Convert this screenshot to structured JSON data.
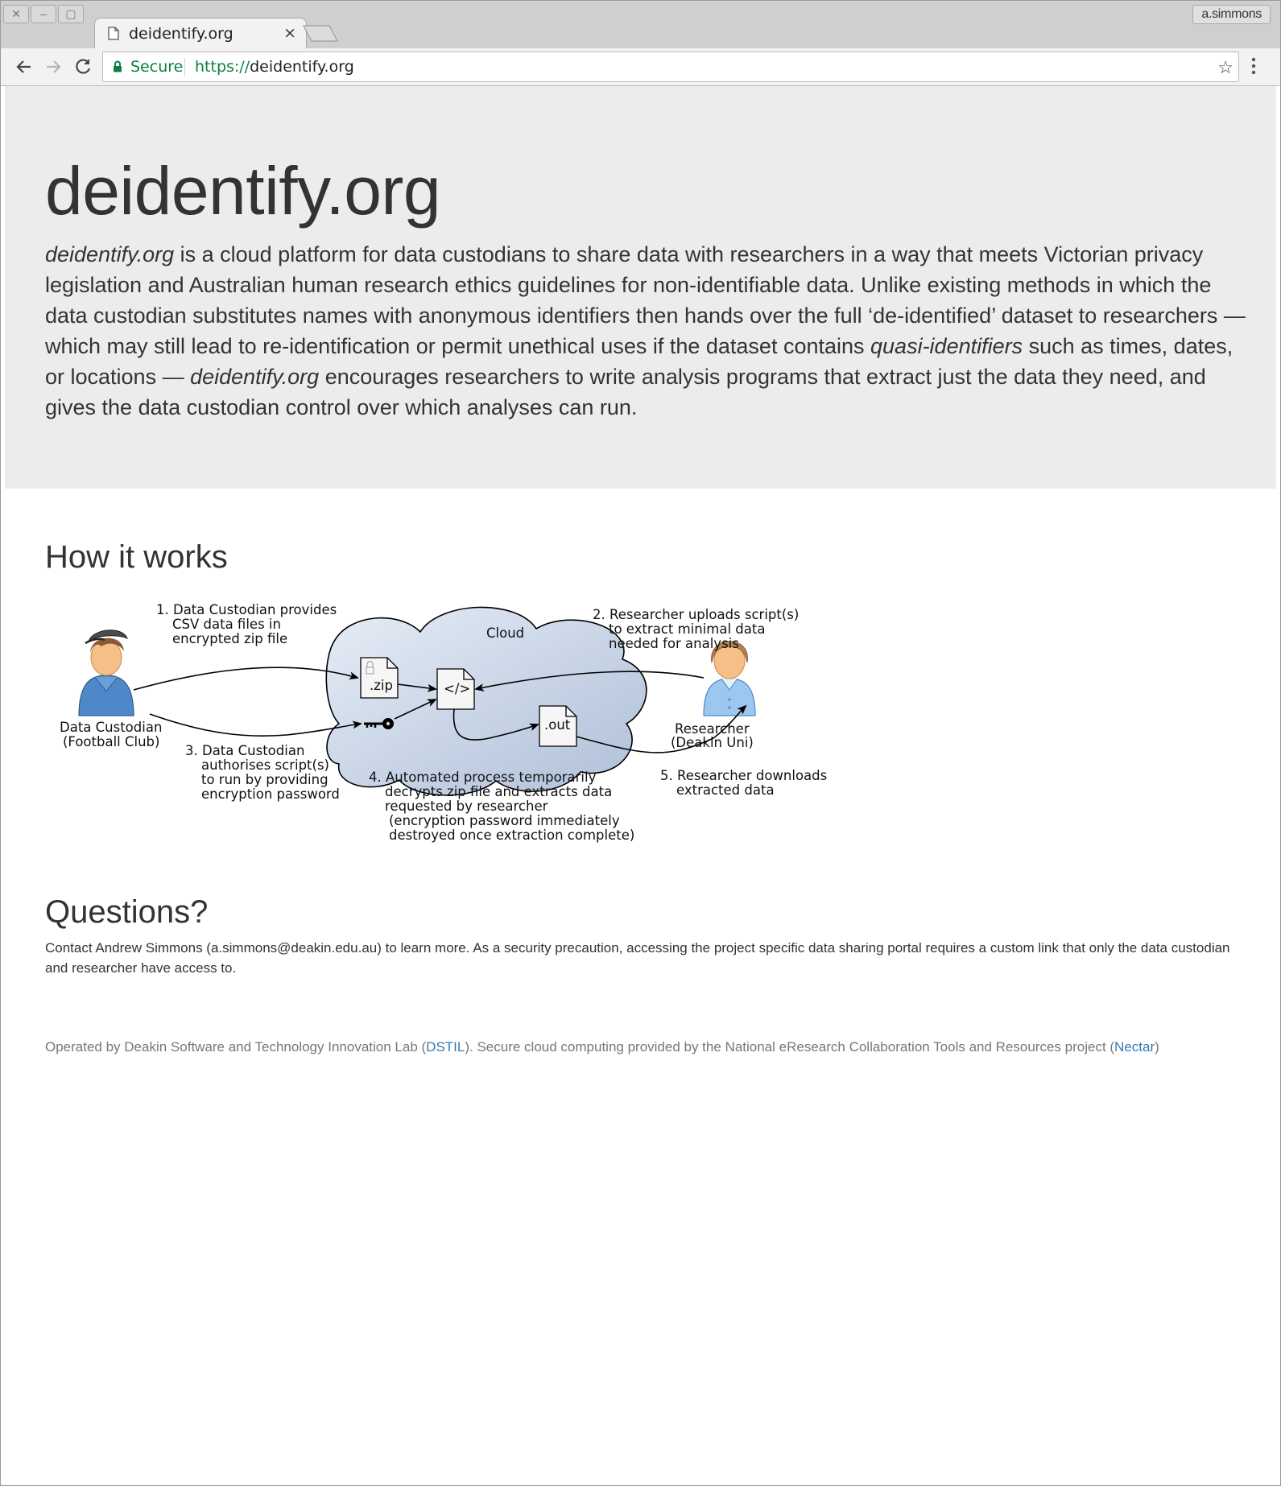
{
  "browser": {
    "tab_title": "deidentify.org",
    "tab_close": "×",
    "profile": "a.simmons",
    "secure_label": "Secure",
    "url_scheme": "https://",
    "url_host": "deidentify.org"
  },
  "hero": {
    "title": "deidentify.org",
    "lead_em_1": "deidentify.org",
    "lead_1": " is a cloud platform for data custodians to share data with researchers in a way that meets Victorian privacy legislation and Australian human research ethics guidelines for non-identifiable data. Unlike existing methods in which the data custodian substitutes names with anonymous identifiers then hands over the full ‘de-identified’ dataset to researchers — which may still lead to re-identification or permit unethical uses if the dataset contains ",
    "lead_em_2": "quasi-identifiers",
    "lead_2": " such as times, dates, or locations — ",
    "lead_em_3": "deidentify.org",
    "lead_3": " encourages researchers to write analysis programs that extract just the data they need, and gives the data custodian control over which analyses can run."
  },
  "how_it_works": {
    "heading": "How it works",
    "cloud_label": "Cloud",
    "zip_label": ".zip",
    "script_label": "</>",
    "out_label": ".out",
    "custodian_name": "Data Custodian",
    "custodian_org": "(Football Club)",
    "researcher_name": "Researcher",
    "researcher_org": "(Deakin Uni)",
    "step1": [
      "1. Data Custodian provides",
      "CSV data files in",
      "encrypted zip file"
    ],
    "step2": [
      "2. Researcher uploads script(s)",
      "to extract minimal data",
      "needed for analysis"
    ],
    "step3": [
      "3. Data Custodian",
      "authorises script(s)",
      "to run by providing",
      "encryption password"
    ],
    "step4": [
      "4. Automated process temporarily",
      "decrypts zip file and extracts data",
      "requested by researcher",
      "(encryption password immediately",
      "destroyed once extraction complete)"
    ],
    "step5": [
      "5. Researcher downloads",
      "extracted data"
    ]
  },
  "questions": {
    "heading": "Questions?",
    "contact": "Contact Andrew Simmons (a.simmons@deakin.edu.au) to learn more. As a security precaution, accessing the project specific data sharing portal requires a custom link that only the data custodian and researcher have access to."
  },
  "footer": {
    "text_1": "Operated by Deakin Software and Technology Innovation Lab (",
    "link_1": "DSTIL",
    "text_2": "). Secure cloud computing provided by the National eResearch Collaboration Tools and Resources project (",
    "link_2": "Nectar",
    "text_3": ")"
  }
}
